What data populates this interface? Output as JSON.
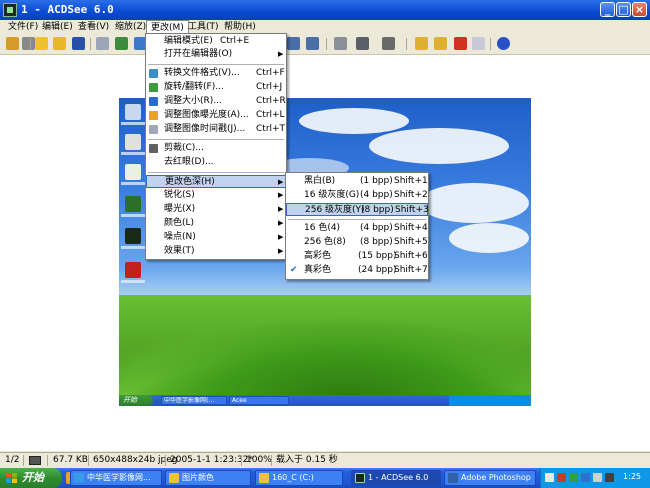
{
  "window": {
    "title": "1 - ACDSee 6.0"
  },
  "menubar": {
    "items": [
      "文件(F)",
      "编辑(E)",
      "查看(V)",
      "缩放(Z)",
      "更改(M)",
      "工具(T)",
      "帮助(H)"
    ]
  },
  "modify_menu": {
    "items": [
      {
        "label": "编辑模式(E)",
        "shortcut": "Ctrl+E"
      },
      {
        "label": "打开在编辑器(O)",
        "shortcut": ""
      },
      {
        "label": "转换文件格式(V)...",
        "shortcut": "Ctrl+F"
      },
      {
        "label": "旋转/翻转(F)...",
        "shortcut": "Ctrl+J"
      },
      {
        "label": "调整大小(R)...",
        "shortcut": "Ctrl+R"
      },
      {
        "label": "调整图像曝光度(A)...",
        "shortcut": "Ctrl+L"
      },
      {
        "label": "调整图像时间戳(J)...",
        "shortcut": "Ctrl+T"
      },
      {
        "label": "剪裁(C)...",
        "shortcut": ""
      },
      {
        "label": "去红眼(D)...",
        "shortcut": ""
      },
      {
        "label": "更改色深(H)",
        "shortcut": ""
      },
      {
        "label": "锐化(S)",
        "shortcut": ""
      },
      {
        "label": "曝光(X)",
        "shortcut": ""
      },
      {
        "label": "颜色(L)",
        "shortcut": ""
      },
      {
        "label": "噪点(N)",
        "shortcut": ""
      },
      {
        "label": "效果(T)",
        "shortcut": ""
      }
    ]
  },
  "color_depth_menu": {
    "items": [
      {
        "label": "黑白(B)",
        "bpp": "(1 bpp)",
        "shortcut": "Shift+1"
      },
      {
        "label": "16 级灰度(G)",
        "bpp": "(4 bpp)",
        "shortcut": "Shift+2"
      },
      {
        "label": "256 级灰度(Y)",
        "bpp": "(8 bpp)",
        "shortcut": "Shift+3"
      },
      {
        "label": "16 色(4)",
        "bpp": "(4 bpp)",
        "shortcut": "Shift+4"
      },
      {
        "label": "256 色(8)",
        "bpp": "(8 bpp)",
        "shortcut": "Shift+5"
      },
      {
        "label": "高彩色",
        "bpp": "(15 bpp)",
        "shortcut": "Shift+6"
      },
      {
        "label": "真彩色",
        "bpp": "(24 bpp)",
        "shortcut": "Shift+7"
      }
    ],
    "checked_index": 6,
    "highlighted_index": 2
  },
  "preview_taskbar": {
    "start": "开始",
    "tasks": [
      "中华医学影像网(…",
      "Acee"
    ]
  },
  "statusbar": {
    "page": "1/2",
    "size": "67.7 KB",
    "dims": "650x488x24b jpeg",
    "date": "2005-1-1 1:23:32*",
    "zoom": "100%",
    "load": "载入于 0.15 秒"
  },
  "taskbar": {
    "start": "开始",
    "tasks": [
      "中华医学影像网...",
      "图片颜色",
      "160_C (C:)",
      "1 - ACDSee 6.0",
      "Adobe Photoshop"
    ],
    "active_index": 3,
    "clock": "1:25"
  },
  "colors": {
    "title": "#0a4ad4",
    "highlight": "#316ac5",
    "taskbar": "#245edb",
    "start": "#2f8c2f"
  }
}
